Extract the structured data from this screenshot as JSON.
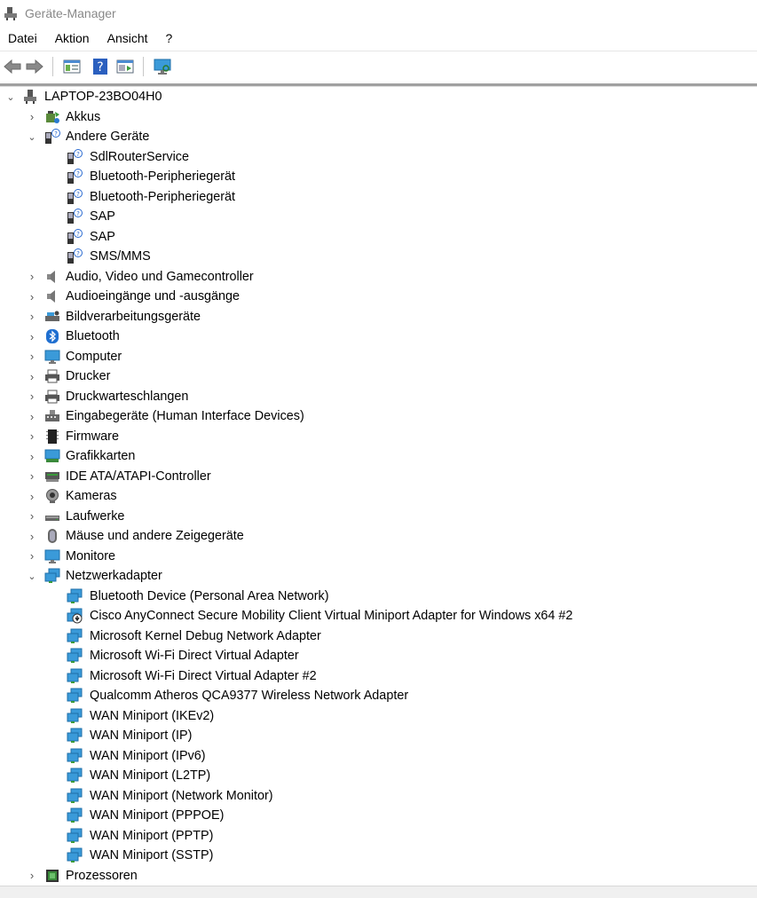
{
  "window": {
    "title": "Geräte-Manager"
  },
  "menu": [
    "Datei",
    "Aktion",
    "Ansicht",
    "?"
  ],
  "toolbar": [
    "back-icon",
    "forward-icon",
    "properties-icon",
    "help-icon",
    "update-driver-icon",
    "monitor-scan-icon"
  ],
  "tree": {
    "root": {
      "label": "LAPTOP-23BO04H0",
      "expanded": true,
      "icon": "computer-tree-root-icon"
    },
    "rows": [
      {
        "label": "Akkus",
        "level": 1,
        "expander": "collapsed",
        "icon": "battery-icon"
      },
      {
        "label": "Andere Geräte",
        "level": 1,
        "expander": "expanded",
        "icon": "unknown-device-icon"
      },
      {
        "label": " SdlRouterService",
        "level": 2,
        "expander": "none",
        "icon": "unknown-device-icon"
      },
      {
        "label": "Bluetooth-Peripheriegerät",
        "level": 2,
        "expander": "none",
        "icon": "unknown-device-icon"
      },
      {
        "label": "Bluetooth-Peripheriegerät",
        "level": 2,
        "expander": "none",
        "icon": "unknown-device-icon"
      },
      {
        "label": "SAP",
        "level": 2,
        "expander": "none",
        "icon": "unknown-device-icon"
      },
      {
        "label": "SAP",
        "level": 2,
        "expander": "none",
        "icon": "unknown-device-icon"
      },
      {
        "label": "SMS/MMS",
        "level": 2,
        "expander": "none",
        "icon": "unknown-device-icon"
      },
      {
        "label": "Audio, Video und Gamecontroller",
        "level": 1,
        "expander": "collapsed",
        "icon": "speaker-icon"
      },
      {
        "label": "Audioeingänge und -ausgänge",
        "level": 1,
        "expander": "collapsed",
        "icon": "speaker-icon"
      },
      {
        "label": "Bildverarbeitungsgeräte",
        "level": 1,
        "expander": "collapsed",
        "icon": "scanner-icon"
      },
      {
        "label": "Bluetooth",
        "level": 1,
        "expander": "collapsed",
        "icon": "bluetooth-icon"
      },
      {
        "label": "Computer",
        "level": 1,
        "expander": "collapsed",
        "icon": "monitor-icon"
      },
      {
        "label": "Drucker",
        "level": 1,
        "expander": "collapsed",
        "icon": "printer-icon"
      },
      {
        "label": "Druckwarteschlangen",
        "level": 1,
        "expander": "collapsed",
        "icon": "printer-icon"
      },
      {
        "label": "Eingabegeräte (Human Interface Devices)",
        "level": 1,
        "expander": "collapsed",
        "icon": "hid-icon"
      },
      {
        "label": "Firmware",
        "level": 1,
        "expander": "collapsed",
        "icon": "chip-icon"
      },
      {
        "label": "Grafikkarten",
        "level": 1,
        "expander": "collapsed",
        "icon": "display-adapter-icon"
      },
      {
        "label": "IDE ATA/ATAPI-Controller",
        "level": 1,
        "expander": "collapsed",
        "icon": "ide-controller-icon"
      },
      {
        "label": "Kameras",
        "level": 1,
        "expander": "collapsed",
        "icon": "camera-icon"
      },
      {
        "label": "Laufwerke",
        "level": 1,
        "expander": "collapsed",
        "icon": "disk-drive-icon"
      },
      {
        "label": "Mäuse und andere Zeigegeräte",
        "level": 1,
        "expander": "collapsed",
        "icon": "mouse-icon"
      },
      {
        "label": "Monitore",
        "level": 1,
        "expander": "collapsed",
        "icon": "monitor-icon"
      },
      {
        "label": "Netzwerkadapter",
        "level": 1,
        "expander": "expanded",
        "icon": "network-adapter-icon"
      },
      {
        "label": "Bluetooth Device (Personal Area Network)",
        "level": 2,
        "expander": "none",
        "icon": "network-adapter-icon"
      },
      {
        "label": "Cisco AnyConnect Secure Mobility Client Virtual Miniport Adapter for Windows x64 #2",
        "level": 2,
        "expander": "none",
        "icon": "network-adapter-disabled-icon"
      },
      {
        "label": "Microsoft Kernel Debug Network Adapter",
        "level": 2,
        "expander": "none",
        "icon": "network-adapter-icon"
      },
      {
        "label": "Microsoft Wi-Fi Direct Virtual Adapter",
        "level": 2,
        "expander": "none",
        "icon": "network-adapter-icon"
      },
      {
        "label": "Microsoft Wi-Fi Direct Virtual Adapter #2",
        "level": 2,
        "expander": "none",
        "icon": "network-adapter-icon"
      },
      {
        "label": "Qualcomm Atheros QCA9377 Wireless Network Adapter",
        "level": 2,
        "expander": "none",
        "icon": "network-adapter-icon"
      },
      {
        "label": "WAN Miniport (IKEv2)",
        "level": 2,
        "expander": "none",
        "icon": "network-adapter-icon"
      },
      {
        "label": "WAN Miniport (IP)",
        "level": 2,
        "expander": "none",
        "icon": "network-adapter-icon"
      },
      {
        "label": "WAN Miniport (IPv6)",
        "level": 2,
        "expander": "none",
        "icon": "network-adapter-icon"
      },
      {
        "label": "WAN Miniport (L2TP)",
        "level": 2,
        "expander": "none",
        "icon": "network-adapter-icon"
      },
      {
        "label": "WAN Miniport (Network Monitor)",
        "level": 2,
        "expander": "none",
        "icon": "network-adapter-icon"
      },
      {
        "label": "WAN Miniport (PPPOE)",
        "level": 2,
        "expander": "none",
        "icon": "network-adapter-icon"
      },
      {
        "label": "WAN Miniport (PPTP)",
        "level": 2,
        "expander": "none",
        "icon": "network-adapter-icon"
      },
      {
        "label": "WAN Miniport (SSTP)",
        "level": 2,
        "expander": "none",
        "icon": "network-adapter-icon"
      },
      {
        "label": "Prozessoren",
        "level": 1,
        "expander": "collapsed",
        "icon": "processor-icon"
      }
    ]
  }
}
